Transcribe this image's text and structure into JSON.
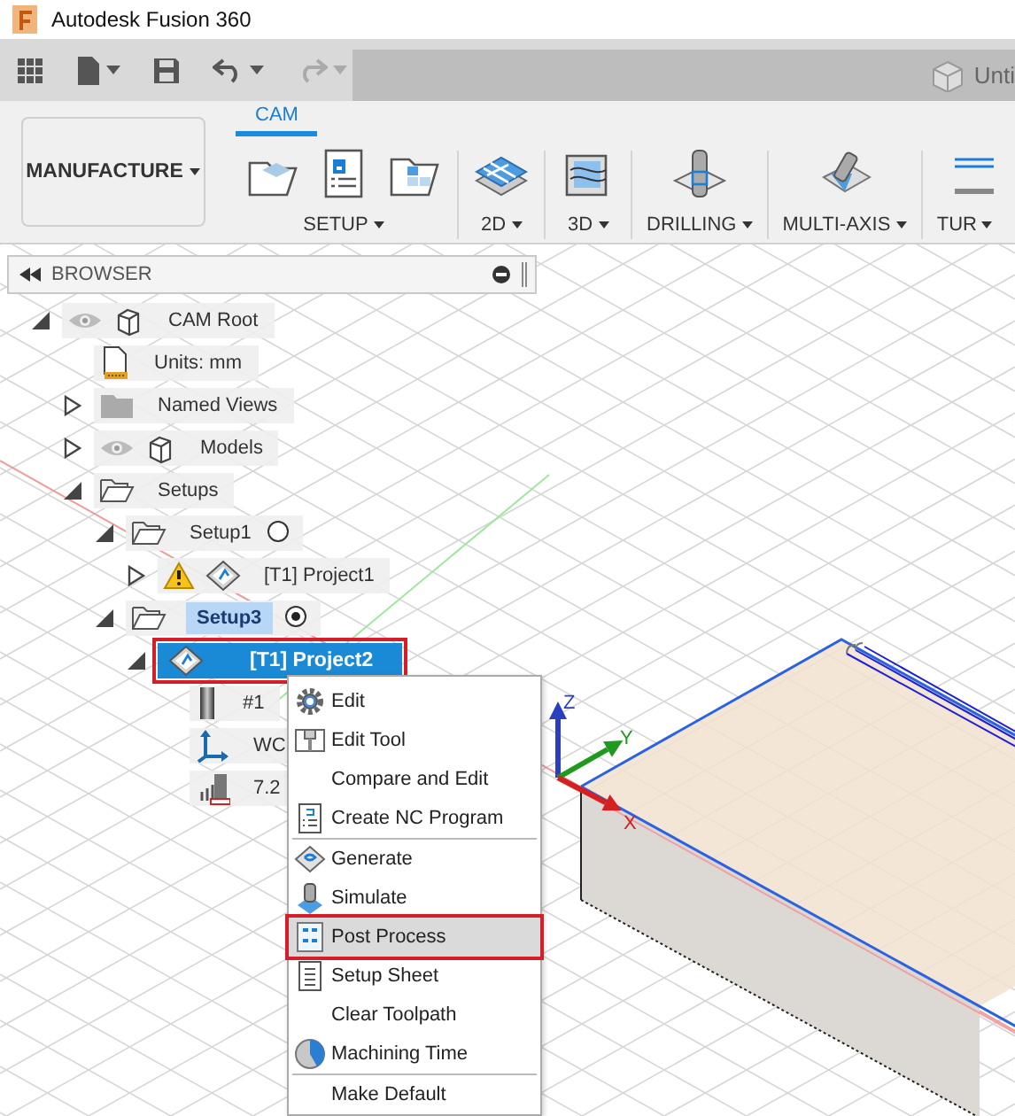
{
  "window": {
    "title": "Autodesk Fusion 360"
  },
  "quick_access": {
    "document_tab": "Unti"
  },
  "ribbon": {
    "workspace": "MANUFACTURE",
    "tabs": [
      {
        "label": "CAM",
        "selected": true
      }
    ],
    "groups": [
      {
        "label": "SETUP"
      },
      {
        "label": "2D"
      },
      {
        "label": "3D"
      },
      {
        "label": "DRILLING"
      },
      {
        "label": "MULTI-AXIS"
      },
      {
        "label": "TUR"
      }
    ]
  },
  "browser": {
    "title": "BROWSER",
    "tree": [
      {
        "kind": "root",
        "label": "CAM Root",
        "expanded": true,
        "selected": false,
        "children": [
          {
            "kind": "units",
            "label": "Units: mm",
            "selected": false
          },
          {
            "kind": "views",
            "label": "Named Views",
            "expanded": false,
            "selected": false
          },
          {
            "kind": "models",
            "label": "Models",
            "expanded": false,
            "selected": false
          },
          {
            "kind": "folder",
            "label": "Setups",
            "expanded": true,
            "selected": false,
            "children": [
              {
                "kind": "setup",
                "label": "Setup1",
                "expanded": true,
                "selected": false,
                "active": false,
                "children": [
                  {
                    "kind": "operation",
                    "label": "[T1] Project1",
                    "expanded": false,
                    "selected": false,
                    "warning": true
                  }
                ]
              },
              {
                "kind": "setup",
                "label": "Setup3",
                "expanded": true,
                "selected": false,
                "active": true,
                "children": [
                  {
                    "kind": "operation",
                    "label": "[T1] Project2",
                    "expanded": true,
                    "selected": true,
                    "warning": false,
                    "children": [
                      {
                        "kind": "tool",
                        "label": "#1",
                        "selected": false
                      },
                      {
                        "kind": "wcs",
                        "label": "WC",
                        "selected": false
                      },
                      {
                        "kind": "stock",
                        "label": "7.2",
                        "selected": false
                      }
                    ]
                  }
                ]
              }
            ]
          }
        ]
      }
    ]
  },
  "context_menu": {
    "groups": [
      [
        {
          "label": "Edit",
          "selected": false
        },
        {
          "label": "Edit Tool",
          "selected": false
        },
        {
          "label": "Compare and Edit",
          "selected": false
        },
        {
          "label": "Create NC Program",
          "selected": false
        }
      ],
      [
        {
          "label": "Generate",
          "selected": false
        },
        {
          "label": "Simulate",
          "selected": false
        },
        {
          "label": "Post Process",
          "selected": true
        },
        {
          "label": "Setup Sheet",
          "selected": false
        },
        {
          "label": "Clear Toolpath",
          "selected": false
        },
        {
          "label": "Machining Time",
          "selected": false
        }
      ],
      [
        {
          "label": "Make Default",
          "selected": false
        }
      ]
    ]
  },
  "viewport": {
    "axes": [
      {
        "label": "Z",
        "color": "#2a3fbf"
      },
      {
        "label": "Y",
        "color": "#1f9a1f"
      },
      {
        "label": "X",
        "color": "#d42020"
      }
    ]
  }
}
